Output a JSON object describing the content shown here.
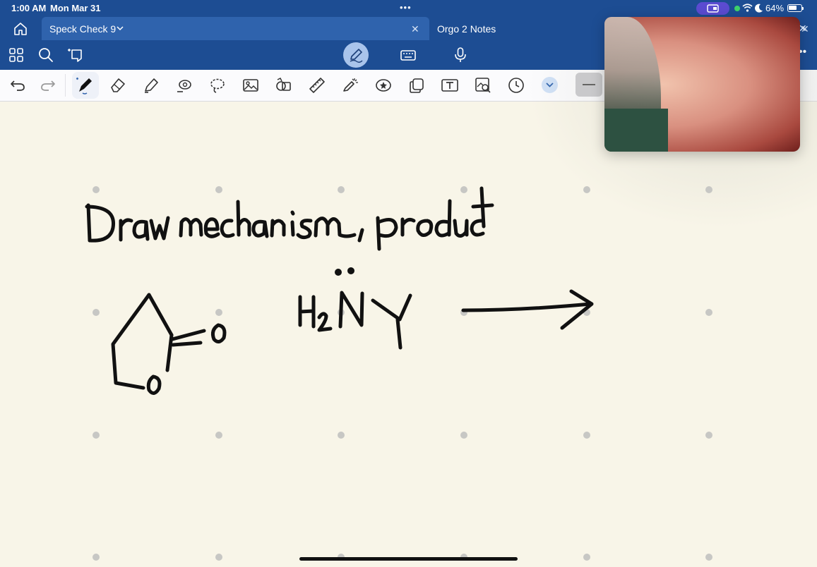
{
  "status_bar": {
    "time": "1:00 AM",
    "date": "Mon Mar 31",
    "battery_percent": "64%",
    "multitask_dots": "•••"
  },
  "tabs": [
    {
      "label": "Speck Check 9",
      "active": true,
      "close": "✕"
    },
    {
      "label": "Orgo 2 Notes",
      "active": false,
      "close": "✕"
    }
  ],
  "top_toolbar": {
    "left_icons": [
      "grid-icon",
      "search-icon",
      "lasso-bookmark-icon"
    ],
    "center_icons": [
      "pencil-mode-icon",
      "keyboard-icon",
      "microphone-icon"
    ],
    "more": "••"
  },
  "tools": [
    "undo-icon",
    "redo-icon",
    "pen-icon",
    "eraser-icon",
    "highlighter-icon",
    "shapes-icon",
    "lasso-icon",
    "image-icon",
    "sticker-icon",
    "ruler-icon",
    "laser-pointer-icon",
    "star-icon",
    "copy-icon",
    "text-box-icon",
    "zoom-image-icon",
    "clock-icon",
    "chevron-down-icon"
  ],
  "note": {
    "handwritten_title": "Draw mechanism, product",
    "reagent": "H2N̈Y"
  },
  "colors": {
    "header_blue": "#1d4d93",
    "active_tab": "#2f63ad",
    "paper": "#f8f5e8",
    "ink": "#111111"
  }
}
